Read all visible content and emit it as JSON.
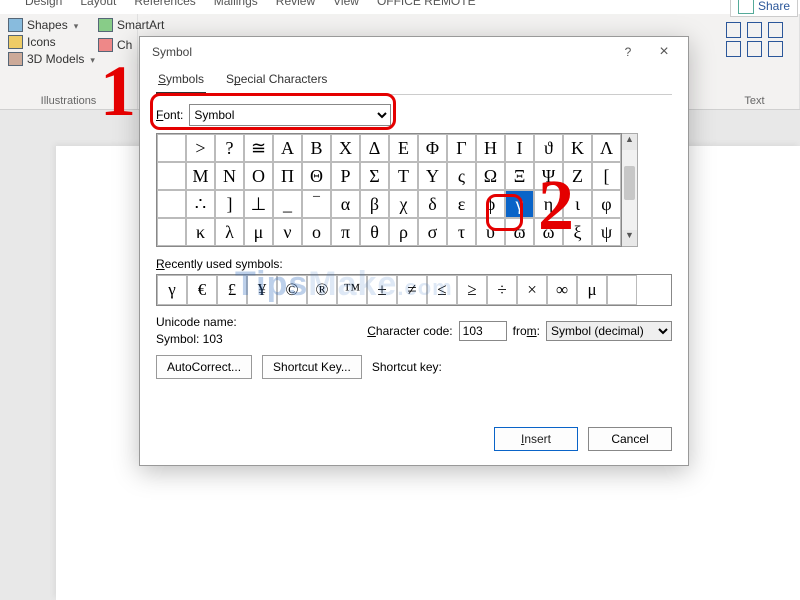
{
  "ribbon": {
    "tabs": [
      "Design",
      "Layout",
      "References",
      "Mailings",
      "Review",
      "View",
      "OFFICE REMOTE"
    ],
    "share": "Share",
    "illustrations": {
      "label": "Illustrations",
      "shapes": "Shapes",
      "icons": "Icons",
      "models": "3D Models",
      "smartart": "SmartArt",
      "chart": "Ch"
    },
    "textgroup": "Text"
  },
  "dialog": {
    "title": "Symbol",
    "help": "?",
    "close": "×",
    "tab_symbols": "Symbols",
    "tab_special": "Special Characters",
    "font_label": "Font:",
    "font_value": "Symbol",
    "grid": [
      ">",
      "?",
      "≅",
      "Α",
      "Β",
      "Χ",
      "Δ",
      "Ε",
      "Φ",
      "Γ",
      "Η",
      "Ι",
      "ϑ",
      "Κ",
      "Λ",
      "Μ",
      "Ν",
      "Ο",
      "Π",
      "Θ",
      "Ρ",
      "Σ",
      "Τ",
      "Υ",
      "ς",
      "Ω",
      "Ξ",
      "Ψ",
      "Ζ",
      "[",
      "∴",
      "]",
      "⊥",
      "_",
      "‾",
      "α",
      "β",
      "χ",
      "δ",
      "ε",
      "ϕ",
      "γ",
      "η",
      "ι",
      "φ",
      "κ",
      "λ",
      "μ",
      "ν",
      "ο",
      "π",
      "θ",
      "ρ",
      "σ",
      "τ",
      "υ",
      "ϖ",
      "ω",
      "ξ",
      "ψ"
    ],
    "selected_index": 41,
    "recent_label": "Recently used symbols:",
    "recent": [
      "γ",
      "€",
      "£",
      "¥",
      "©",
      "®",
      "™",
      "±",
      "≠",
      "≤",
      "≥",
      "÷",
      "×",
      "∞",
      "μ",
      ""
    ],
    "uni_label": "Unicode name:",
    "uni_value": "Symbol: 103",
    "cc_label": "Character code:",
    "cc_value": "103",
    "from_label": "from:",
    "from_value": "Symbol (decimal)",
    "autocorrect": "AutoCorrect...",
    "shortcutkey_btn": "Shortcut Key...",
    "shortcutkey_label": "Shortcut key:",
    "insert": "Insert",
    "cancel": "Cancel"
  },
  "annotations": {
    "one": "1",
    "two": "2"
  },
  "watermark": "TipsMake.com"
}
